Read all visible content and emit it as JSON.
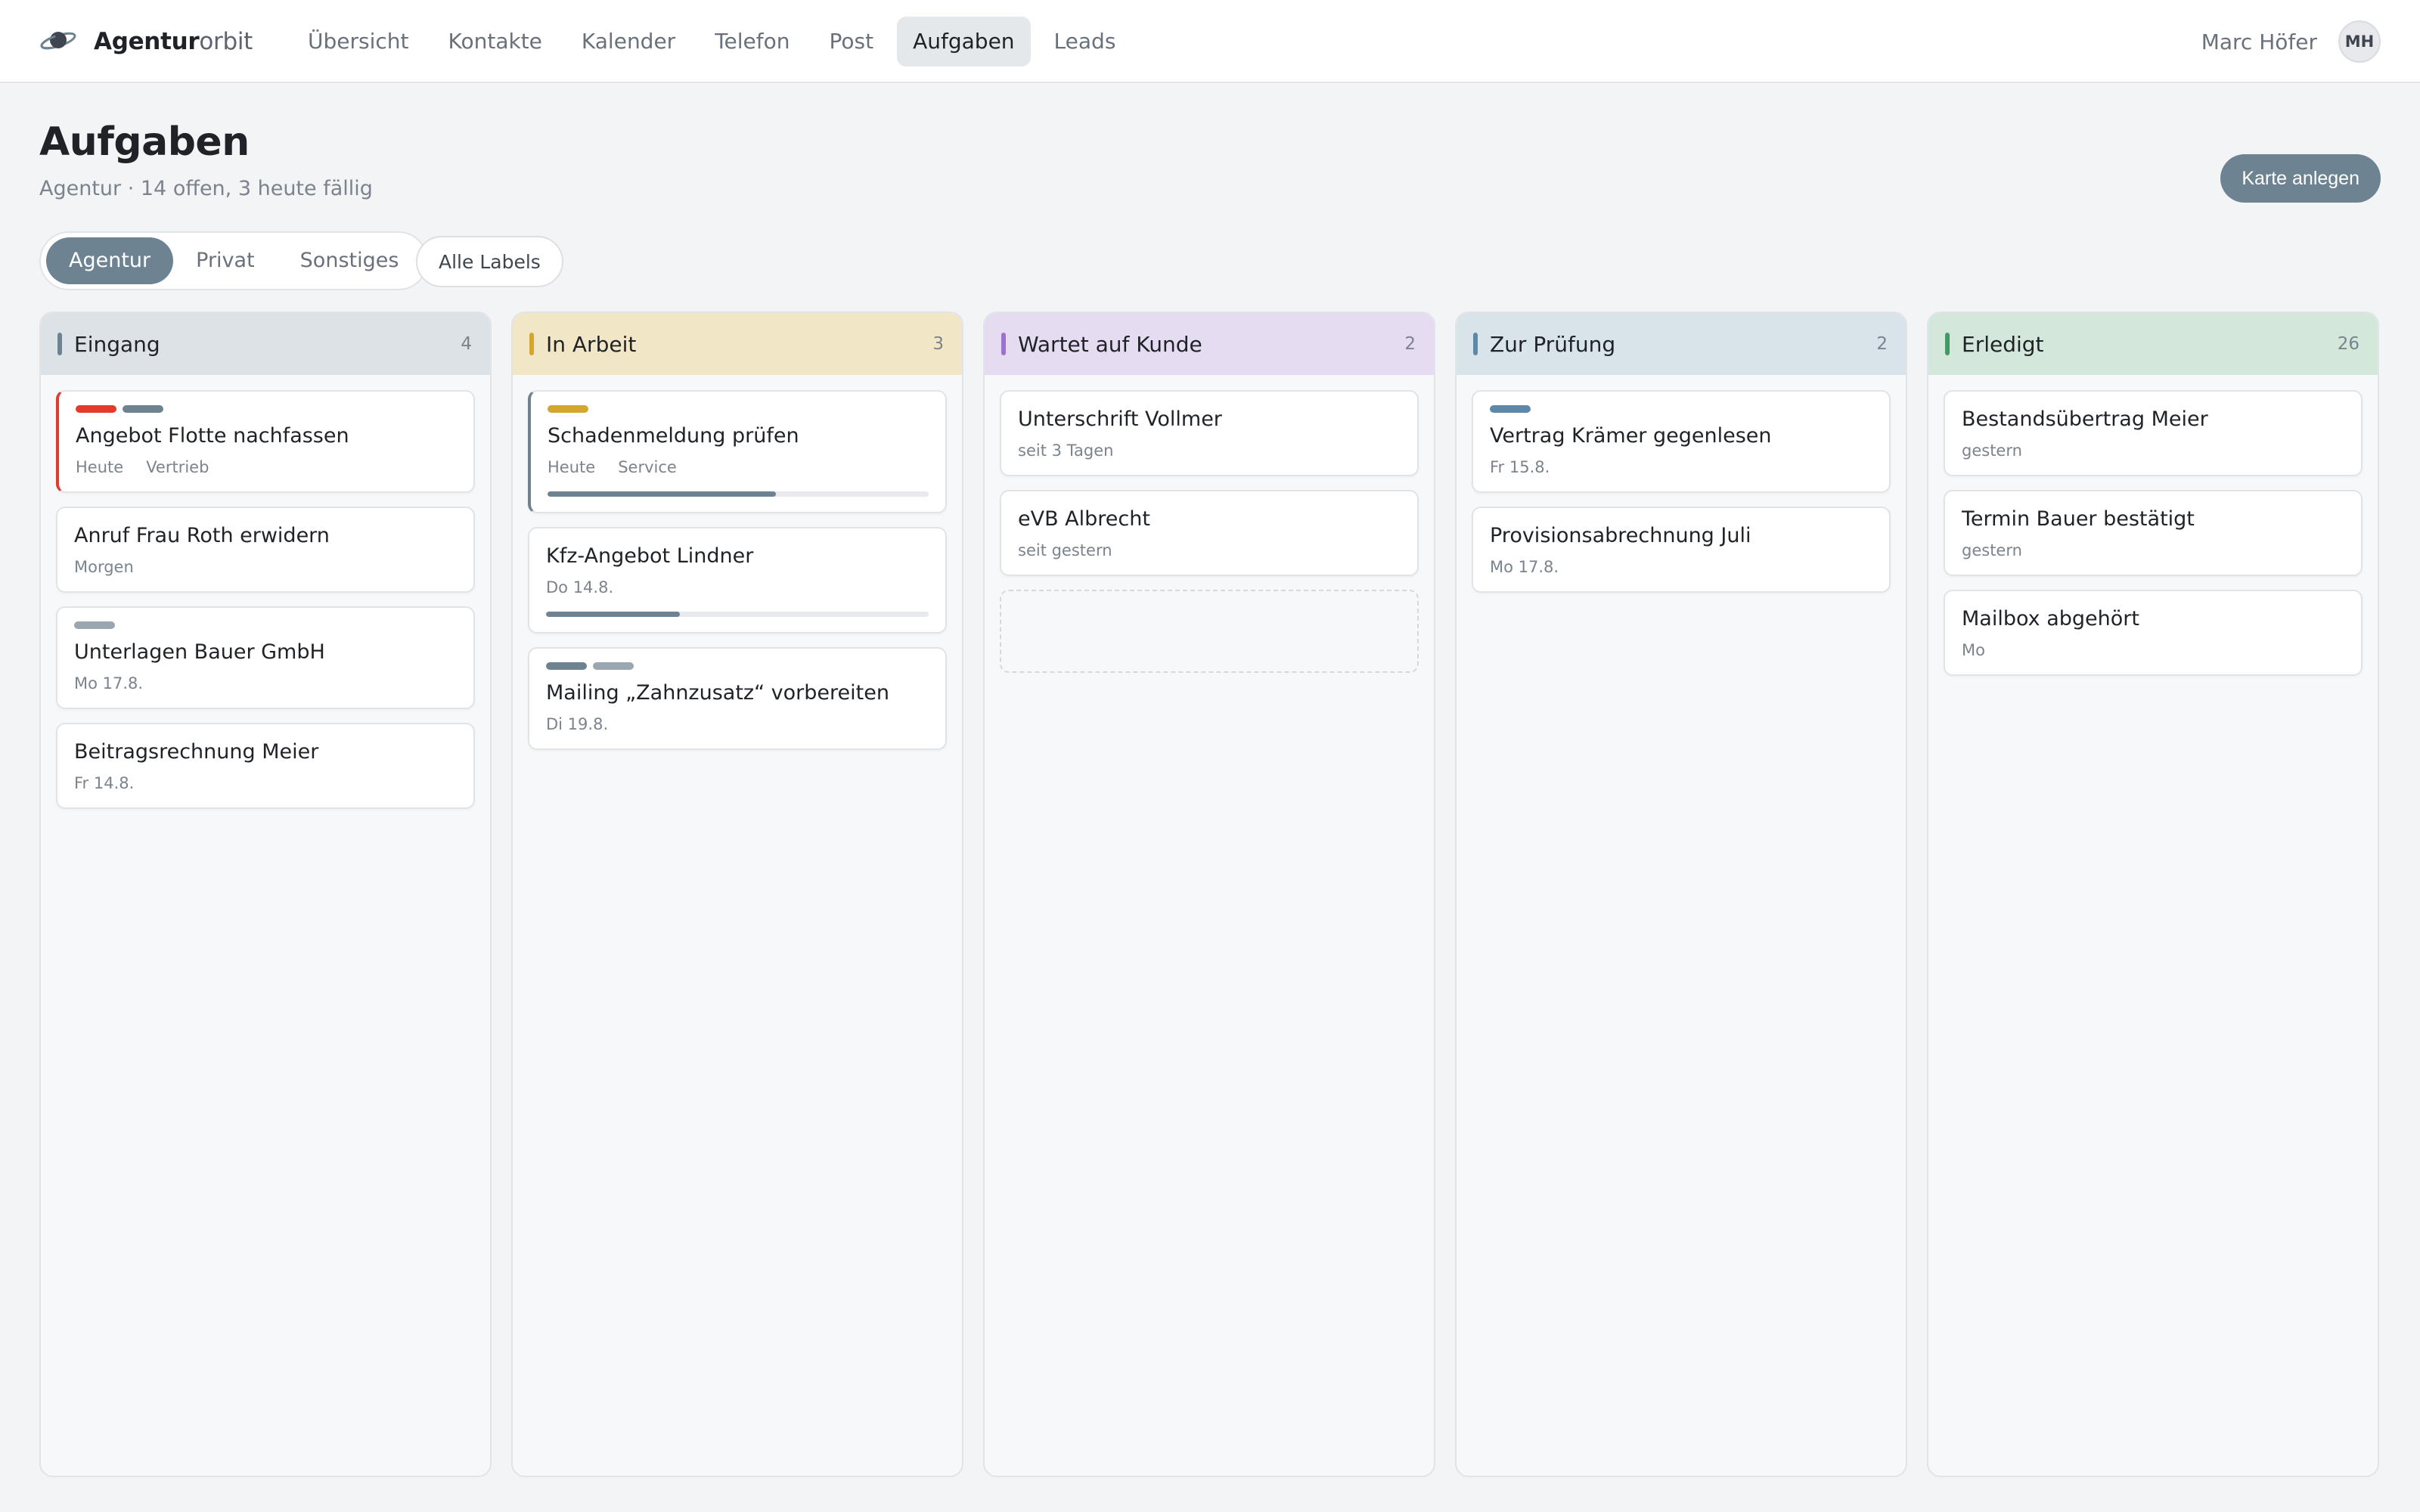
{
  "app": {
    "name_part1": "Agentur",
    "name_part2": "orbit"
  },
  "nav": {
    "items": [
      {
        "label": "Übersicht",
        "active": false
      },
      {
        "label": "Kontakte",
        "active": false
      },
      {
        "label": "Kalender",
        "active": false
      },
      {
        "label": "Telefon",
        "active": false
      },
      {
        "label": "Post",
        "active": false
      },
      {
        "label": "Aufgaben",
        "active": true
      },
      {
        "label": "Leads",
        "active": false
      }
    ]
  },
  "user": {
    "name": "Marc Höfer",
    "initials": "MH"
  },
  "page": {
    "title": "Aufgaben",
    "subtitle": "Agentur · 14 offen, 3 heute fällig",
    "create_label": "Karte anlegen"
  },
  "filters": {
    "segments": [
      {
        "label": "Agentur",
        "active": true
      },
      {
        "label": "Privat",
        "active": false
      },
      {
        "label": "Sonstiges",
        "active": false
      }
    ],
    "labels_button": "Alle Labels"
  },
  "colors": {
    "accent": "#6e8392",
    "red": "#e23a2b",
    "gray_tag": "#9aa7b1",
    "yellow": "#d4a72c"
  },
  "columns": [
    {
      "title": "Eingang",
      "count": "4",
      "header_bg": "#dde2e6",
      "bar": "#6e8392",
      "cards": [
        {
          "title": "Angebot Flotte nachfassen",
          "meta": [
            "Heute",
            "Vertrieb"
          ],
          "tags": [
            "#e23a2b",
            "#6e8392"
          ],
          "highlight": "red"
        },
        {
          "title": "Anruf Frau Roth erwidern",
          "meta": [
            "Morgen"
          ],
          "tags": []
        },
        {
          "title": "Unterlagen Bauer GmbH",
          "meta": [
            "Mo 17.8."
          ],
          "tags": [
            "#9aa7b1"
          ]
        },
        {
          "title": "Beitragsrechnung Meier",
          "meta": [
            "Fr 14.8."
          ],
          "tags": []
        }
      ]
    },
    {
      "title": "In Arbeit",
      "count": "3",
      "header_bg": "#f1e6c6",
      "bar": "#d4a72c",
      "cards": [
        {
          "title": "Schadenmeldung prüfen",
          "meta": [
            "Heute",
            "Service"
          ],
          "tags": [
            "#d4a72c"
          ],
          "highlight": "blue",
          "progress": 0.6
        },
        {
          "title": "Kfz-Angebot Lindner",
          "meta": [
            "Do 14.8."
          ],
          "tags": [],
          "progress": 0.35
        },
        {
          "title": "Mailing „Zahnzusatz“ vorbereiten",
          "meta": [
            "Di 19.8."
          ],
          "tags": [
            "#6e8392",
            "#9aa7b1"
          ]
        }
      ]
    },
    {
      "title": "Wartet auf Kunde",
      "count": "2",
      "header_bg": "#e6dcf1",
      "bar": "#9b72cf",
      "cards": [
        {
          "title": "Unterschrift Vollmer",
          "meta": [
            "seit 3 Tagen"
          ],
          "tags": []
        },
        {
          "title": "eVB Albrecht",
          "meta": [
            "seit gestern"
          ],
          "tags": []
        }
      ],
      "drop_zone": true
    },
    {
      "title": "Zur Prüfung",
      "count": "2",
      "header_bg": "#d9e3ea",
      "bar": "#5d88a8",
      "cards": [
        {
          "title": "Vertrag Krämer gegenlesen",
          "meta": [
            "Fr 15.8."
          ],
          "tags": [
            "#5d88a8"
          ]
        },
        {
          "title": "Provisionsabrechnung Juli",
          "meta": [
            "Mo 17.8."
          ],
          "tags": []
        }
      ]
    },
    {
      "title": "Erledigt",
      "count": "26",
      "header_bg": "#d3e8da",
      "bar": "#3f9a63",
      "cards": [
        {
          "title": "Bestandsübertrag Meier",
          "meta": [
            "gestern"
          ],
          "tags": []
        },
        {
          "title": "Termin Bauer bestätigt",
          "meta": [
            "gestern"
          ],
          "tags": []
        },
        {
          "title": "Mailbox abgehört",
          "meta": [
            "Mo"
          ],
          "tags": []
        }
      ]
    }
  ]
}
